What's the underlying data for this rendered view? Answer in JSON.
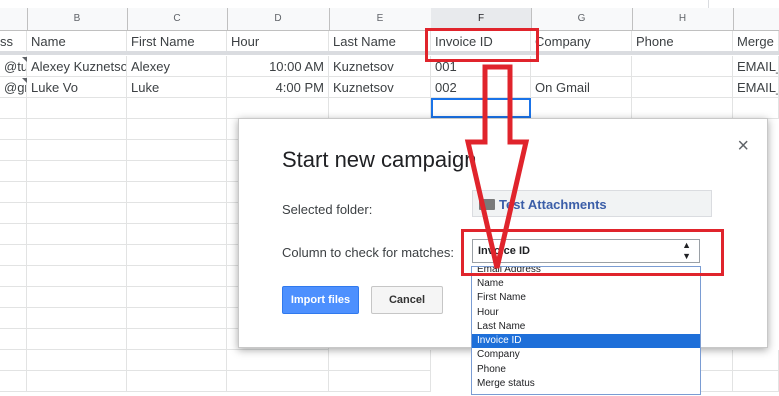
{
  "sheet": {
    "col_letters": [
      "B",
      "C",
      "D",
      "E",
      "F",
      "G",
      "H"
    ],
    "headers": [
      "ss",
      "Name",
      "First Name",
      "Hour",
      "Last Name",
      "Invoice ID",
      "Company",
      "Phone",
      "Merge s"
    ],
    "rows": [
      [
        "@tu",
        "Alexey Kuznetso",
        "Alexey",
        "10:00 AM",
        "Kuznetsov",
        "001",
        "",
        "",
        "EMAIL_"
      ],
      [
        "@gm",
        "Luke Vo",
        "Luke",
        "4:00 PM",
        "Kuznetsov",
        "002",
        "On Gmail",
        "",
        "EMAIL_"
      ]
    ]
  },
  "dialog": {
    "title": "Start new campaign",
    "selected_folder_label": "Selected folder:",
    "folder_name": "Test Attachments",
    "column_label": "Column to check for matches:",
    "selected_column": "Invoice ID",
    "import_button": "Import files",
    "cancel_button": "Cancel",
    "close_glyph": "×",
    "select_arrows": "▲\n▼"
  },
  "dropdown": {
    "options": [
      "Email Address",
      "Name",
      "First Name",
      "Hour",
      "Last Name",
      "Invoice ID",
      "Company",
      "Phone",
      "Merge status"
    ],
    "highlighted": "Invoice ID"
  },
  "annotation_color": "#e0242c"
}
